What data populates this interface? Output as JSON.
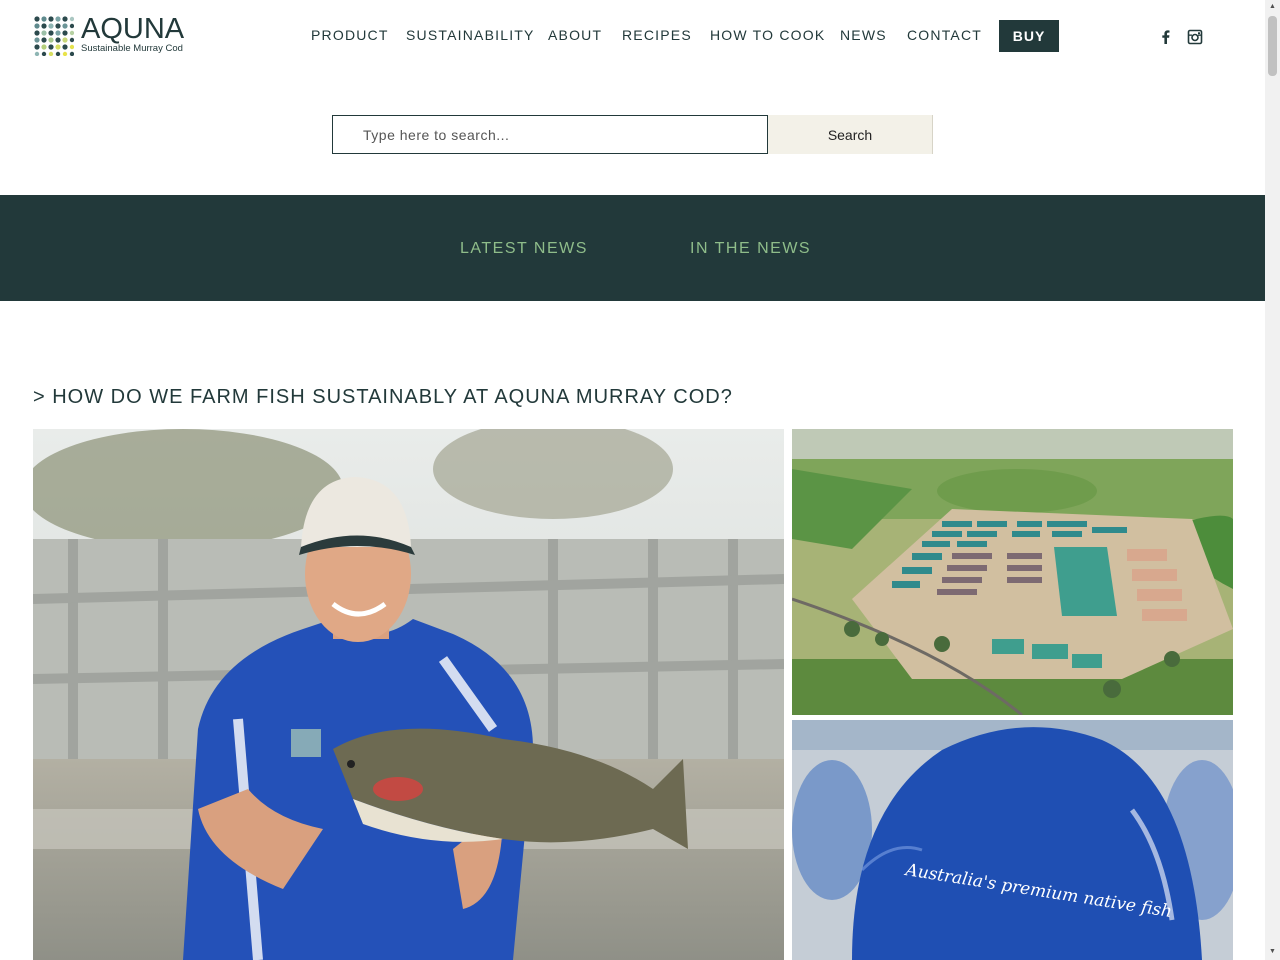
{
  "header": {
    "logo_word": "AQUNA",
    "logo_tagline": "Sustainable Murray Cod",
    "nav": [
      {
        "label": "PRODUCT"
      },
      {
        "label": "SUSTAINABILITY"
      },
      {
        "label": "ABOUT"
      },
      {
        "label": "RECIPES"
      },
      {
        "label": "HOW TO COOK"
      },
      {
        "label": "NEWS"
      },
      {
        "label": "CONTACT"
      }
    ],
    "buy_label": "BUY",
    "social_icons": [
      "facebook-icon",
      "instagram-icon"
    ]
  },
  "search": {
    "placeholder": "Type here to search...",
    "button_label": "Search"
  },
  "news_tabs": [
    {
      "label": "LATEST NEWS"
    },
    {
      "label": "IN THE NEWS"
    }
  ],
  "article": {
    "heading": "> HOW DO WE FARM FISH SUSTAINABLY AT AQUNA MURRAY COD?",
    "jacket_text": "Australia's premium native fish"
  },
  "colors": {
    "brand_dark": "#22393a",
    "tab_green": "#8fbd8a",
    "search_button_bg": "#f3f1e8"
  }
}
